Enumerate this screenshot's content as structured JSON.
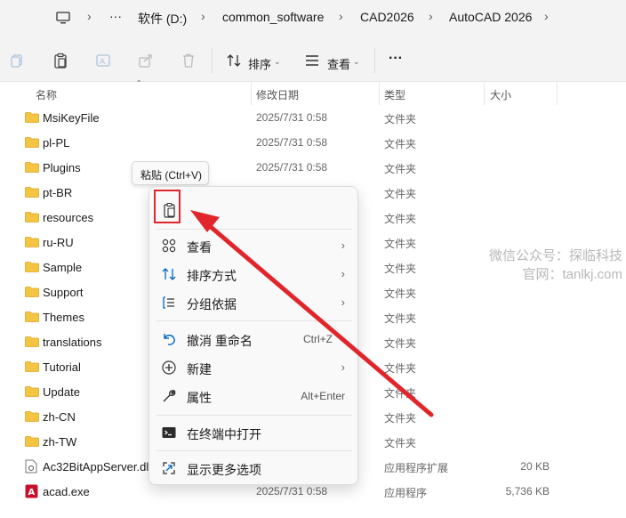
{
  "address_bar": {
    "more": "···",
    "crumbs": [
      "软件 (D:)",
      "common_software",
      "CAD2026",
      "AutoCAD 2026"
    ]
  },
  "toolbar": {
    "sort_label": "排序",
    "view_label": "查看",
    "more_label": "···"
  },
  "columns": {
    "name": "名称",
    "date": "修改日期",
    "type": "类型",
    "size": "大小"
  },
  "files": [
    {
      "name": "MsiKeyFile",
      "date": "2025/7/31 0:58",
      "type": "文件夹",
      "size": "",
      "kind": "folder"
    },
    {
      "name": "pl-PL",
      "date": "2025/7/31 0:58",
      "type": "文件夹",
      "size": "",
      "kind": "folder"
    },
    {
      "name": "Plugins",
      "date": "2025/7/31 0:58",
      "type": "文件夹",
      "size": "",
      "kind": "folder"
    },
    {
      "name": "pt-BR",
      "date": "",
      "type": "文件夹",
      "size": "",
      "kind": "folder"
    },
    {
      "name": "resources",
      "date": "",
      "type": "文件夹",
      "size": "",
      "kind": "folder"
    },
    {
      "name": "ru-RU",
      "date": "",
      "type": "文件夹",
      "size": "",
      "kind": "folder"
    },
    {
      "name": "Sample",
      "date": "",
      "type": "文件夹",
      "size": "",
      "kind": "folder"
    },
    {
      "name": "Support",
      "date": "",
      "type": "文件夹",
      "size": "",
      "kind": "folder"
    },
    {
      "name": "Themes",
      "date": "",
      "type": "文件夹",
      "size": "",
      "kind": "folder"
    },
    {
      "name": "translations",
      "date": "",
      "type": "文件夹",
      "size": "",
      "kind": "folder"
    },
    {
      "name": "Tutorial",
      "date": "",
      "type": "文件夹",
      "size": "",
      "kind": "folder"
    },
    {
      "name": "Update",
      "date": "",
      "type": "文件夹",
      "size": "",
      "kind": "folder"
    },
    {
      "name": "zh-CN",
      "date": "",
      "type": "文件夹",
      "size": "",
      "kind": "folder"
    },
    {
      "name": "zh-TW",
      "date": "",
      "type": "文件夹",
      "size": "",
      "kind": "folder"
    },
    {
      "name": "Ac32BitAppServer.dll",
      "date": "",
      "type": "应用程序扩展",
      "size": "20 KB",
      "kind": "dll"
    },
    {
      "name": "acad.exe",
      "date": "2025/7/31 0:58",
      "type": "应用程序",
      "size": "5,736 KB",
      "kind": "exe"
    }
  ],
  "tooltip": "粘贴 (Ctrl+V)",
  "context_menu": {
    "view": "查看",
    "sort": "排序方式",
    "group": "分组依据",
    "undo": "撤消 重命名",
    "undo_shortcut": "Ctrl+Z",
    "new": "新建",
    "properties": "属性",
    "properties_shortcut": "Alt+Enter",
    "terminal": "在终端中打开",
    "more_options": "显示更多选项"
  },
  "watermark": {
    "line1": "微信公众号：探临科技",
    "line2": "官网：tanlkj.com"
  },
  "colors": {
    "folder": "#f4c542",
    "annotation_red": "#e0262b",
    "accent": "#0067c0"
  }
}
